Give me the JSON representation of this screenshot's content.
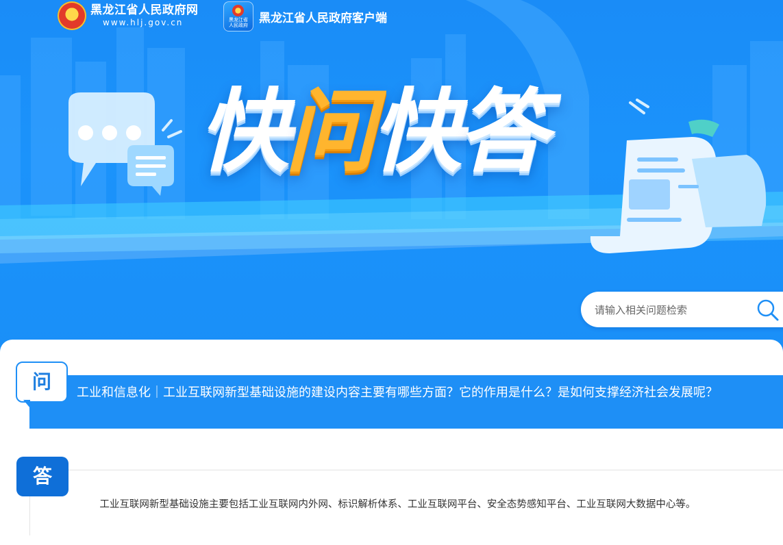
{
  "header": {
    "portal_name": "黑龙江省人民政府网",
    "portal_url": "www.hlj.gov.cn",
    "app_icon_lines": [
      "黑龙江省",
      "人民政府"
    ],
    "app_name": "黑龙江省人民政府客户端"
  },
  "hero": {
    "chars": [
      "快",
      "问",
      "快",
      "答"
    ]
  },
  "search": {
    "placeholder": "请输入相关问题检索"
  },
  "qa": {
    "question_badge": "问",
    "question": "工业和信息化｜工业互联网新型基础设施的建设内容主要有哪些方面？它的作用是什么？是如何支撑经济社会发展呢？",
    "answer_badge": "答",
    "answer": "工业互联网新型基础设施主要包括工业互联网内外网、标识解析体系、工业互联网平台、安全态势感知平台、工业互联网大数据中心等。"
  },
  "colors": {
    "banner_blue": "#1a8cf7",
    "question_bar": "#1e8ff6",
    "answer_badge": "#0f6fd8",
    "accent_orange": "#ffb52e"
  },
  "icons": [
    "national-emblem-icon",
    "app-icon",
    "chat-bubble-icon",
    "document-scroll-icon",
    "search-icon"
  ]
}
